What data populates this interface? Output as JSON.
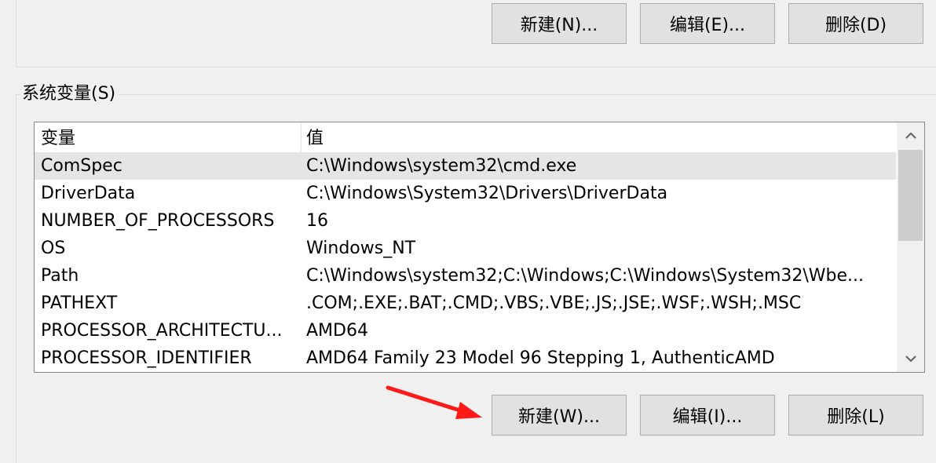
{
  "user_vars": {
    "buttons": {
      "new_label": "新建(N)...",
      "edit_label": "编辑(E)...",
      "delete_label": "删除(D)"
    }
  },
  "system_vars": {
    "group_label": "系统变量(S)",
    "columns": {
      "variable": "变量",
      "value": "值"
    },
    "rows": [
      {
        "name": "ComSpec",
        "value": "C:\\Windows\\system32\\cmd.exe"
      },
      {
        "name": "DriverData",
        "value": "C:\\Windows\\System32\\Drivers\\DriverData"
      },
      {
        "name": "NUMBER_OF_PROCESSORS",
        "value": "16"
      },
      {
        "name": "OS",
        "value": "Windows_NT"
      },
      {
        "name": "Path",
        "value": "C:\\Windows\\system32;C:\\Windows;C:\\Windows\\System32\\Wbe..."
      },
      {
        "name": "PATHEXT",
        "value": ".COM;.EXE;.BAT;.CMD;.VBS;.VBE;.JS;.JSE;.WSF;.WSH;.MSC"
      },
      {
        "name": "PROCESSOR_ARCHITECTU...",
        "value": "AMD64"
      },
      {
        "name": "PROCESSOR_IDENTIFIER",
        "value": "AMD64 Family 23 Model 96 Stepping 1, AuthenticAMD"
      }
    ],
    "selected_row": 0,
    "buttons": {
      "new_label": "新建(W)...",
      "edit_label": "编辑(I)...",
      "delete_label": "删除(L)"
    }
  },
  "icons": {
    "scroll_up": "chevron-up-icon",
    "scroll_down": "chevron-down-icon",
    "annotation": "red-arrow-icon"
  },
  "colors": {
    "annotation_arrow": "#ff1a1a",
    "selected_row": "#e5e5e5",
    "button_face": "#e1e1e1"
  }
}
